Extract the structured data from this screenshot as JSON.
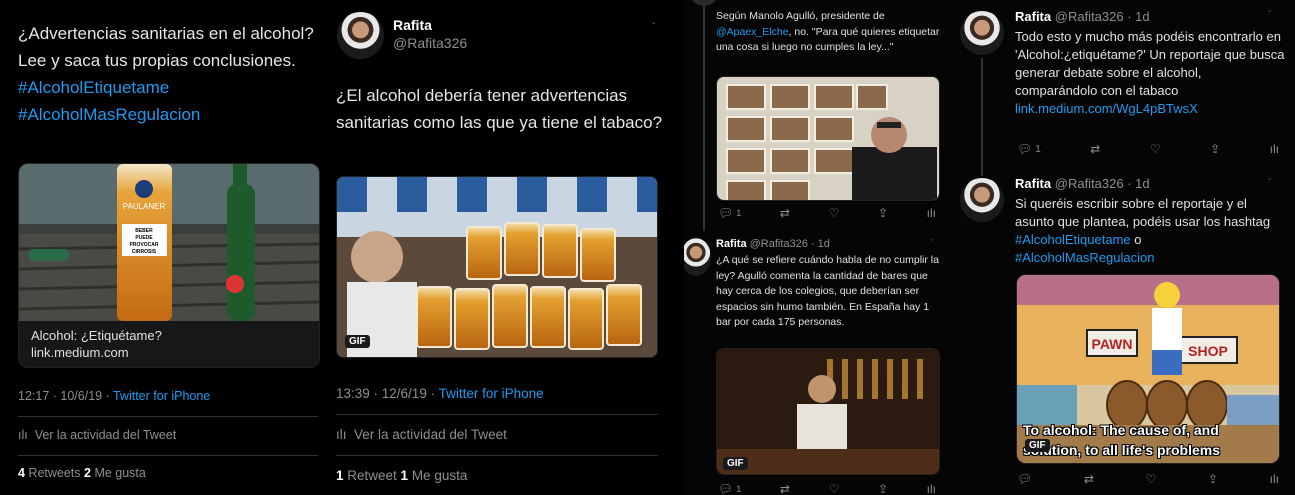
{
  "panel1": {
    "text": "¿Advertencias sanitarias en el alcohol? Lee y saca tus propias conclusiones.",
    "hashtag1": "#AlcoholEtiquetame",
    "hashtag2": "#AlcoholMasRegulacion",
    "glass_label": "PAULANER",
    "sign_text": "BEBER PUEDE PROVOCAR CIRROSIS",
    "card_title": "Alcohol: ¿Etiquétame?",
    "card_domain": "link.medium.com",
    "time": "12:17 · 10/6/19 · ",
    "client": "Twitter for iPhone",
    "activity": "Ver la actividad del Tweet",
    "retweets_count": "4",
    "retweets_label": " Retweets ",
    "likes_count": "2",
    "likes_label": " Me gusta"
  },
  "panel2": {
    "name": "Rafita",
    "handle": "@Rafita326",
    "text": "¿El alcohol debería tener advertencias sanitarias como las que ya tiene el tabaco?",
    "gif": "GIF",
    "time": "13:39 · 12/6/19 · ",
    "client": "Twitter for iPhone",
    "activity": "Ver la actividad del Tweet",
    "retweets_count": "1",
    "retweets_label": " Retweet ",
    "likes_count": "1",
    "likes_label": " Me gusta"
  },
  "panel3": {
    "top_text_prefix": "Según Manolo Agulló, presidente de ",
    "top_mention": "@Apaex_Elche",
    "top_text_suffix": ", no. \"Para qué quieres etiquetar una cosa si luego no cumples la ley...\"",
    "reply_count_1": "1",
    "name": "Rafita",
    "handle_meta": "@Rafita326 · 1d",
    "text": "¿A qué se refiere cuándo habla de no cumplir la ley? Agulló comenta la cantidad de bares que hay cerca de los colegios, que deberían ser espacios sin humo también. En España hay 1 bar por cada 175 personas.",
    "gif": "GIF",
    "reply_count_2": "1"
  },
  "panel4": {
    "tweet1": {
      "name": "Rafita",
      "handle_meta": "@Rafita326 · 1d",
      "text": "Todo esto y mucho más podéis encontrarlo en 'Alcohol:¿etiquétame?' Un reportaje que busca generar debate sobre el alcohol, comparándolo con el tabaco",
      "link": "link.medium.com/WgL4pBTwsX",
      "reply_count": "1"
    },
    "tweet2": {
      "name": "Rafita",
      "handle_meta": "@Rafita326 · 1d",
      "text_prefix": "Si queréis escribir sobre el reportaje y el asunto que plantea, podéis usar los hashtag ",
      "hashtag1": "#AlcoholEtiquetame",
      "text_mid": " o",
      "hashtag2": "#AlcoholMasRegulacion",
      "sign_left": "PAWN",
      "sign_right": "SHOP",
      "caption": "To alcohol: The cause of, and solution, to all life's problems",
      "gif": "GIF"
    }
  },
  "icons": {
    "reply": "reply-icon",
    "retweet": "retweet-icon",
    "like": "heart-icon",
    "share": "share-icon",
    "stats": "stats-icon",
    "chevron": "chevron-down-icon"
  }
}
